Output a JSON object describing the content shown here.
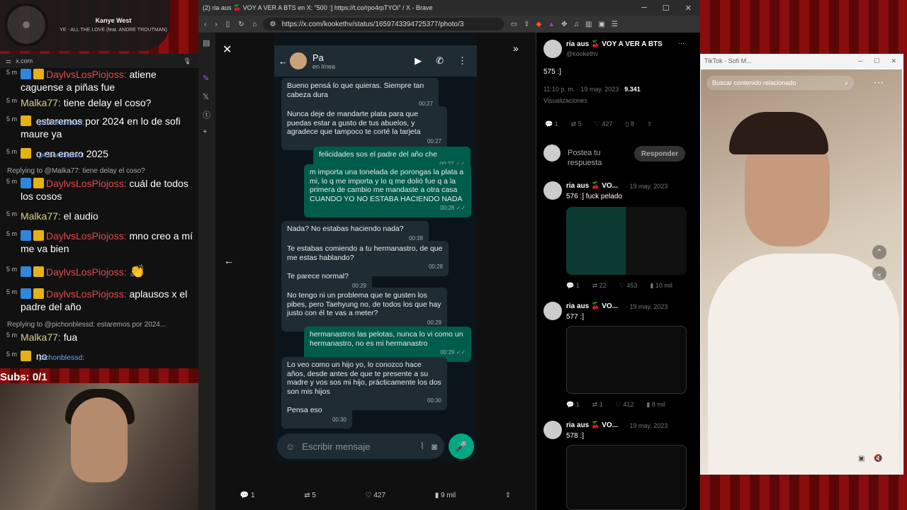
{
  "spotify": {
    "artist": "Kanye West",
    "song": "YE - ALL THE LOVE (feat. ANDRE TROUTMAN)"
  },
  "chat": {
    "domain": "x.com",
    "messages": [
      {
        "time": "5 m",
        "user": "DaylvsLosPiojoss:",
        "text": "atiene caguense a piñas fue",
        "color": "r"
      },
      {
        "time": "5 m",
        "user": "Malka77:",
        "text": "tiene delay el coso?",
        "color": "y"
      },
      {
        "time": "5 m",
        "user": "pichonblessd:",
        "text": "estaremos por 2024 en lo de sofi maure ya",
        "color": "b"
      },
      {
        "time": "5 m",
        "user": "pichonblessd:",
        "text": "o en enero 2025",
        "color": "b"
      },
      {
        "time": "5 m",
        "user": "DaylvsLosPiojoss:",
        "text": "cuál de todos los cosos",
        "color": "r",
        "reply": "Replying to @Malka77: tiene delay el coso?"
      },
      {
        "time": "5 m",
        "user": "Malka77:",
        "text": "el audio",
        "color": "y"
      },
      {
        "time": "5 m",
        "user": "DaylvsLosPiojoss:",
        "text": "mno creo a mí me va bien",
        "color": "r"
      },
      {
        "time": "5 m",
        "user": "DaylvsLosPiojoss:",
        "text": "",
        "color": "r"
      },
      {
        "time": "5 m",
        "user": "DaylvsLosPiojoss:",
        "text": "aplausos x el padre del año",
        "color": "r"
      },
      {
        "time": "5 m",
        "user": "Malka77:",
        "text": "fua",
        "color": "y",
        "reply": "Replying to @pichonblessd: estaremos por 2024..."
      },
      {
        "time": "5 m",
        "user": "pichonblessd:",
        "text": "no",
        "color": "b"
      }
    ],
    "subs": "Subs: 0/1"
  },
  "browser": {
    "title": "(2) ria aus 🍒 VOY A VER A BTS en X: \"500 :] https://t.co/rpo4rpTYOi\" / X - Brave",
    "url": "https://x.com/kookethv/status/1659743394725377/photo/3"
  },
  "whatsapp": {
    "contact": "Pa",
    "status": "en línea",
    "placeholder": "Escribir mensaje",
    "bubbles": [
      {
        "dir": "in",
        "text": "Bueno pensá lo que quieras. Siempre tan cabeza dura",
        "time": "00:27"
      },
      {
        "dir": "in",
        "text": "Nunca deje de mandarte plata para que puedas estar a gusto de tus abuelos, y agradece que tampoco te corté la tarjeta",
        "time": "00:27"
      },
      {
        "dir": "out",
        "text": "felicidades sos el padre del año che",
        "time": "00:27 ✓✓"
      },
      {
        "dir": "out",
        "text": "m importa una tonelada de porongas la plata a mi, lo q me importa y lo q me dolió fue q a la primera de cambio me mandaste a otra casa CUANDO YO NO ESTABA HACIENDO NADA",
        "time": "00:28 ✓✓"
      },
      {
        "dir": "in",
        "text": "Nada? No estabas haciendo nada?",
        "time": "00:28"
      },
      {
        "dir": "in",
        "text": "Te estabas comiendo a tu hermanastro, de que me estas hablando?",
        "time": "00:28"
      },
      {
        "dir": "in",
        "text": "Te parece normal?",
        "time": "00:29"
      },
      {
        "dir": "in",
        "text": "No tengo ni un problema que te gusten los pibes, pero Taehyung no, de todos los que hay justo con él te vas a meter?",
        "time": "00:29"
      },
      {
        "dir": "out",
        "text": "hermanastros las pelotas, nunca lo vi como un hermanastro, no es mi hermanastro",
        "time": "00:29 ✓✓"
      },
      {
        "dir": "in",
        "text": "Lo veo como un hijo yo, lo conozco hace años, desde antes de que te presente a su madre y vos sos mi hijo, prácticamente los dos son mis hijos",
        "time": "00:30"
      },
      {
        "dir": "in",
        "text": "Pensa eso",
        "time": "00:30"
      }
    ]
  },
  "viewer_actions": {
    "replies": "1",
    "reposts": "5",
    "likes": "427",
    "views": "9 mil"
  },
  "tweet": {
    "name": "ria aus 🍒 VOY A VER A BTS",
    "handle": "@kookethv",
    "text": "575 :]",
    "meta": "11:10 p. m. · 19 may. 2023 ·",
    "views": "9.341",
    "views_label": "Visualizaciones",
    "stats": [
      "1",
      "5",
      "427",
      "8"
    ],
    "reply_placeholder": "Postea tu respuesta",
    "reply_button": "Responder",
    "replies": [
      {
        "name": "ria aus 🍒 VO...",
        "date": "· 19 may. 2023",
        "text": "576 :] fuck pelado",
        "stats": [
          "1",
          "22",
          "453",
          "10 mil"
        ]
      },
      {
        "name": "ria aus 🍒 VO...",
        "date": "· 19 may. 2023",
        "text": "577 :]",
        "stats": [
          "1",
          "1",
          "412",
          "8 mil"
        ]
      },
      {
        "name": "ria aus 🍒 VO...",
        "date": "· 19 may. 2023",
        "text": "578 :]",
        "stats": []
      }
    ]
  },
  "tiktok": {
    "title": "TikTok - Sofi M...",
    "search": "Buscar contenido relacionado"
  }
}
